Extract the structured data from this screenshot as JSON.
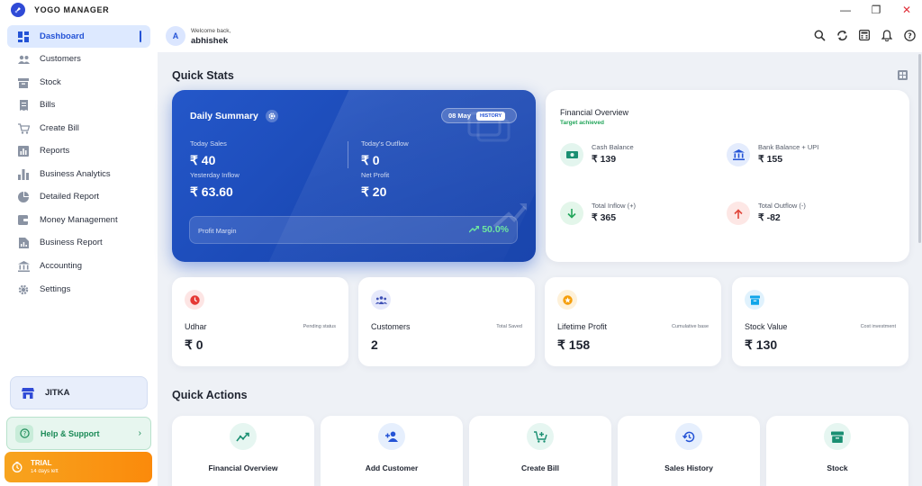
{
  "app": {
    "title": "YOGO MANAGER"
  },
  "window": {
    "minimize": "—",
    "maximize": "❐",
    "close": "✕"
  },
  "sidebar": {
    "items": [
      {
        "label": "Dashboard",
        "icon": "dashboard-icon",
        "active": true
      },
      {
        "label": "Customers",
        "icon": "people-icon"
      },
      {
        "label": "Stock",
        "icon": "box-icon"
      },
      {
        "label": "Bills",
        "icon": "receipt-icon"
      },
      {
        "label": "Create Bill",
        "icon": "cart-icon"
      },
      {
        "label": "Reports",
        "icon": "report-icon"
      },
      {
        "label": "Business Analytics",
        "icon": "bar-chart-icon"
      },
      {
        "label": "Detailed Report",
        "icon": "pie-chart-icon"
      },
      {
        "label": "Money Management",
        "icon": "wallet-icon"
      },
      {
        "label": "Business Report",
        "icon": "document-chart-icon"
      },
      {
        "label": "Accounting",
        "icon": "bank-icon"
      },
      {
        "label": "Settings",
        "icon": "gear-icon"
      }
    ],
    "store": {
      "name": "JITKA"
    },
    "help": {
      "label": "Help & Support"
    },
    "trial": {
      "title": "TRIAL",
      "subtitle": "14 days left"
    }
  },
  "header": {
    "avatar_initial": "A",
    "welcome": "Welcome back,",
    "username": "abhishek",
    "icons": [
      "search-icon",
      "sync-icon",
      "calculator-icon",
      "bell-icon",
      "help-icon"
    ]
  },
  "quick_stats": {
    "title": "Quick Stats",
    "daily_summary": {
      "title": "Daily Summary",
      "date": "08 May",
      "history_label": "HISTORY",
      "today_sales_label": "Today Sales",
      "today_sales": "₹ 40",
      "today_outflow_label": "Today's Outflow",
      "today_outflow": "₹ 0",
      "yesterday_inflow_label": "Yesterday Inflow",
      "yesterday_inflow": "₹ 63.60",
      "net_profit_label": "Net Profit",
      "net_profit": "₹ 20",
      "profit_margin_label": "Profit Margin",
      "profit_margin": "50.0%"
    },
    "financial_overview": {
      "title": "Financial Overview",
      "subtitle": "Target achieved",
      "items": [
        {
          "label": "Cash Balance",
          "value": "₹ 139",
          "icon": "cash-icon",
          "color": "#1a8f72",
          "bg": "#e3f5ee"
        },
        {
          "label": "Bank Balance + UPI",
          "value": "₹ 155",
          "icon": "bank-icon",
          "color": "#2453d6",
          "bg": "#e4ecfd"
        },
        {
          "label": "Total Inflow (+)",
          "value": "₹ 365",
          "icon": "arrow-down-icon",
          "color": "#22a55a",
          "bg": "#e3f6ea"
        },
        {
          "label": "Total Outflow (-)",
          "value": "₹ -82",
          "icon": "arrow-up-icon",
          "color": "#e0473b",
          "bg": "#fde7e5"
        }
      ]
    },
    "cards": [
      {
        "label": "Udhar",
        "note": "Pending status",
        "value": "₹ 0",
        "icon": "clock-icon",
        "color": "#e53935",
        "bg": "#fde5e4"
      },
      {
        "label": "Customers",
        "note": "Total Saved",
        "value": "2",
        "icon": "group-icon",
        "color": "#3f51b5",
        "bg": "#e6e9fb"
      },
      {
        "label": "Lifetime Profit",
        "note": "Cumulative base",
        "value": "₹ 158",
        "icon": "star-icon",
        "color": "#f59e0b",
        "bg": "#fef1d9"
      },
      {
        "label": "Stock Value",
        "note": "Cost investment",
        "value": "₹ 130",
        "icon": "archive-icon",
        "color": "#0ea5e9",
        "bg": "#e0f2fd"
      }
    ]
  },
  "quick_actions": {
    "title": "Quick Actions",
    "items": [
      {
        "label": "Financial Overview",
        "icon": "trend-icon"
      },
      {
        "label": "Add Customer",
        "icon": "add-person-icon"
      },
      {
        "label": "Create Bill",
        "icon": "cart-plus-icon"
      },
      {
        "label": "Sales History",
        "icon": "history-icon"
      },
      {
        "label": "Stock",
        "icon": "archive-icon"
      }
    ]
  }
}
